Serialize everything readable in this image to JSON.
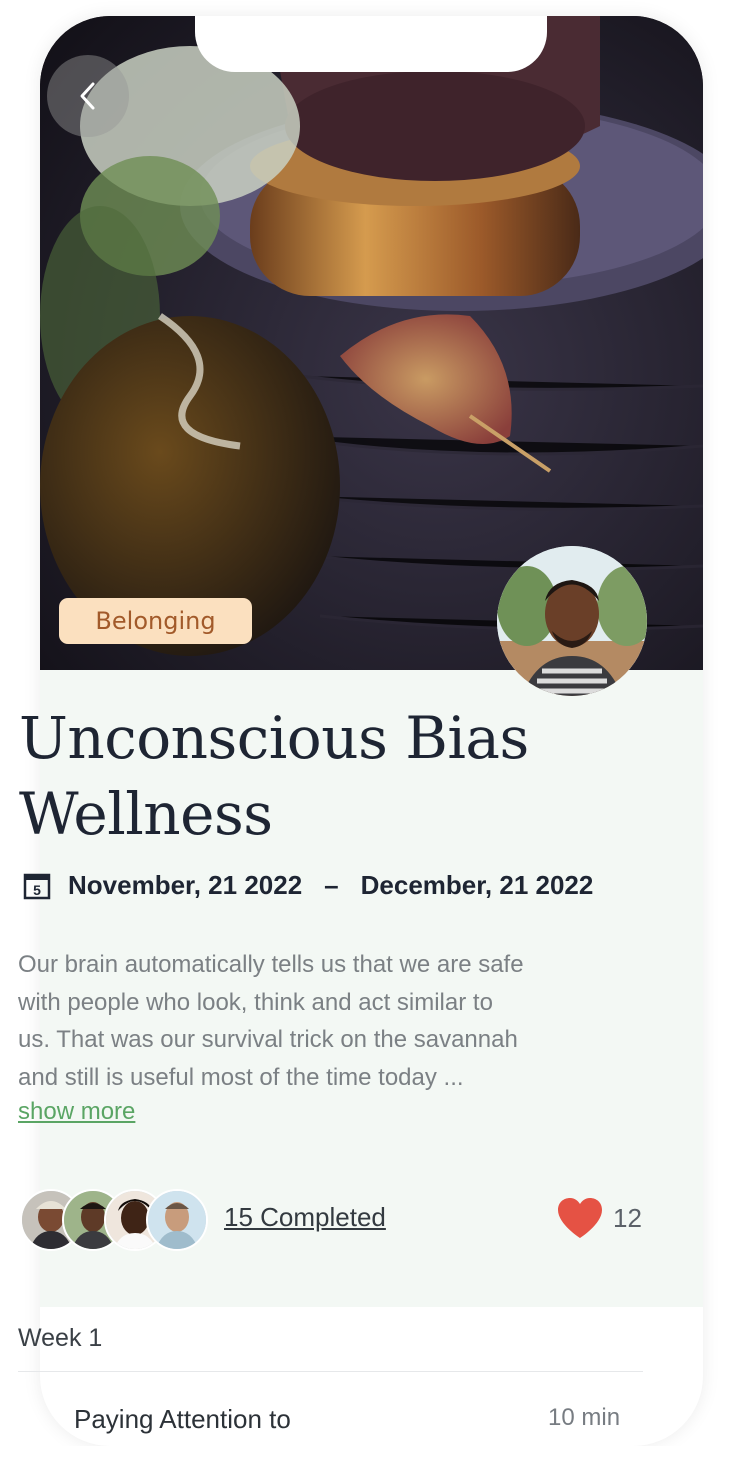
{
  "course": {
    "tag": "Belonging",
    "title_line1": "Unconscious Bias",
    "title_line2": "Wellness",
    "start_date": "November, 21 2022",
    "date_separator": "–",
    "end_date": "December, 21 2022",
    "calendar_day": "5",
    "description_lines": [
      "Our brain automatically tells us that we are safe",
      "with people who look, think and act similar to",
      "us. That was our survival trick on the savannah",
      "and still is useful most of the time today ..."
    ],
    "show_more": "show more",
    "completed_label": "15 Completed",
    "likes": "12"
  },
  "week": {
    "label": "Week 1",
    "lesson_title": "Paying Attention to",
    "lesson_duration": "10 min"
  },
  "colors": {
    "tag_bg": "#fbe0bf",
    "tag_text": "#a25a2a",
    "content_bg": "#f3f8f4",
    "link_green": "#5aa564",
    "heart_red": "#e55244"
  },
  "icons": {
    "back": "chevron-left-icon",
    "calendar": "calendar-icon",
    "like": "heart-icon"
  }
}
